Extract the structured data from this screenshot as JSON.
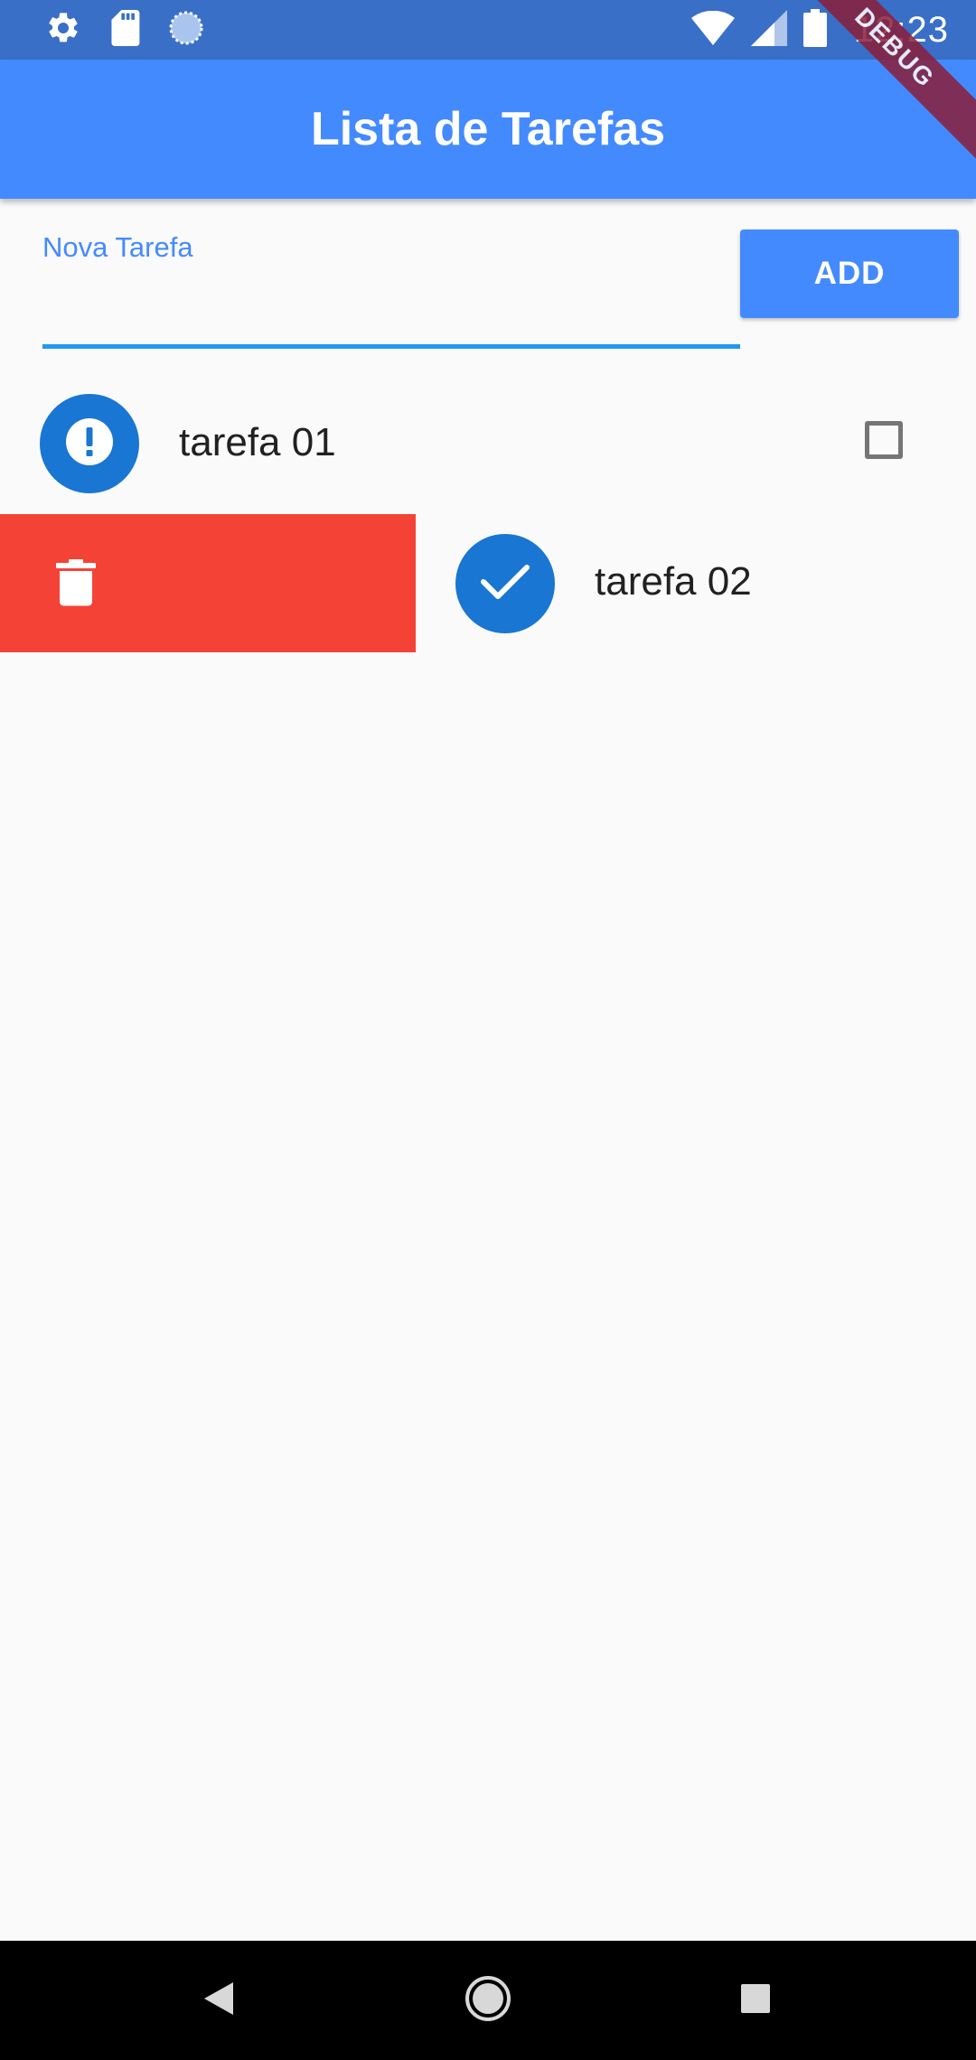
{
  "status_bar": {
    "time": "12:23",
    "left_icons": [
      "gear-icon",
      "sd-card-icon",
      "sync-icon"
    ],
    "right_icons": [
      "wifi-icon",
      "signal-icon",
      "battery-icon"
    ]
  },
  "debug_banner": "DEBUG",
  "app_bar": {
    "title": "Lista de Tarefas"
  },
  "new_task": {
    "label": "Nova Tarefa",
    "value": "",
    "add_label": "ADD"
  },
  "tasks": [
    {
      "title": "tarefa 01",
      "done": false,
      "icon": "exclamation-icon",
      "dismissing": false
    },
    {
      "title": "tarefa 02",
      "done": true,
      "icon": "check-icon",
      "dismissing": true
    }
  ],
  "dismiss_background": {
    "icon": "trash-icon",
    "color": "#f44336"
  },
  "colors": {
    "primary": "#448aff",
    "avatar": "#1976d2",
    "delete": "#f44336"
  },
  "nav_bar": {
    "buttons": [
      "back-icon",
      "home-icon",
      "recents-icon"
    ]
  }
}
